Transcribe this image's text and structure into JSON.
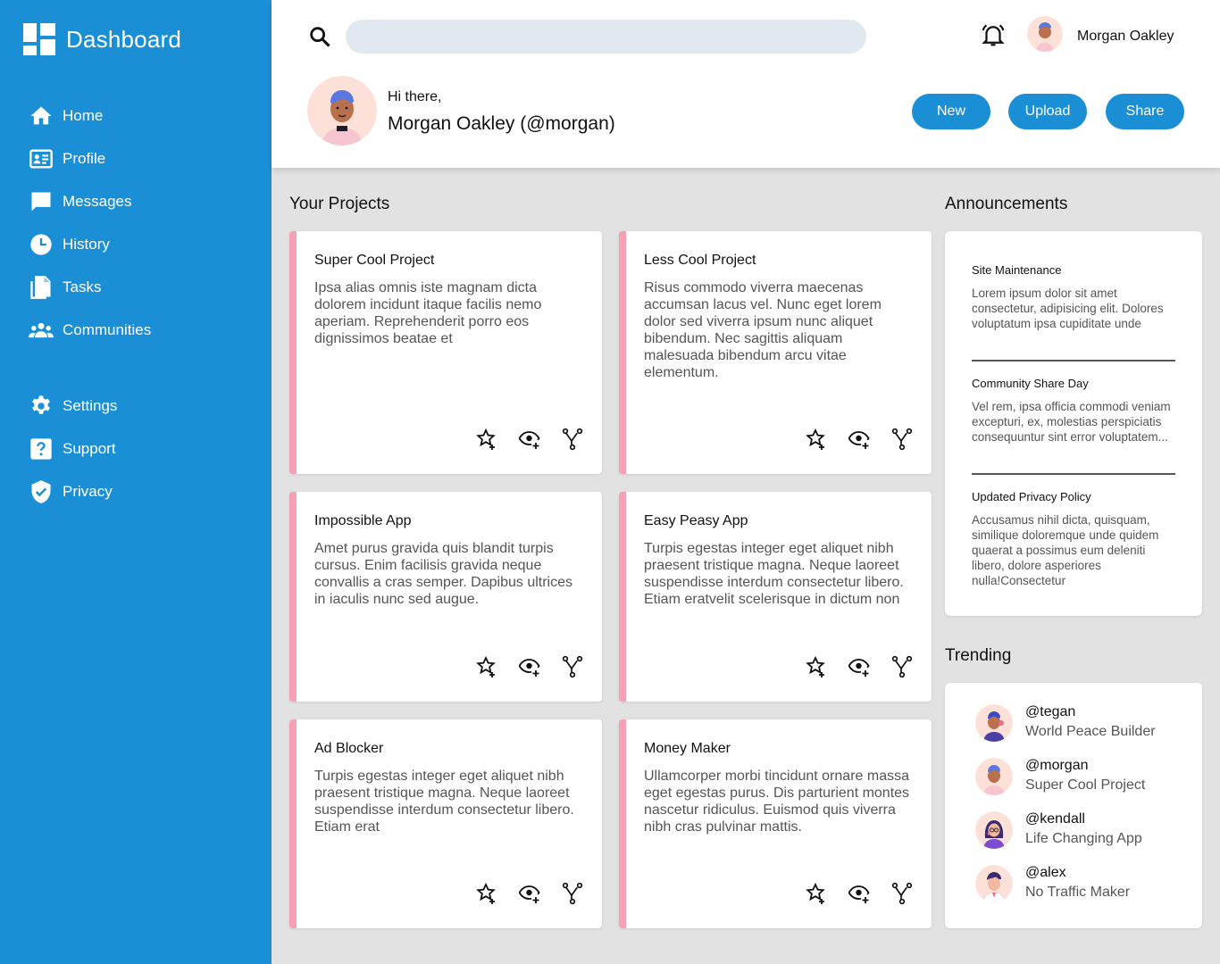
{
  "app": {
    "title": "Dashboard"
  },
  "sidebar": {
    "items": [
      {
        "label": "Home",
        "icon": "home-icon"
      },
      {
        "label": "Profile",
        "icon": "profile-card-icon"
      },
      {
        "label": "Messages",
        "icon": "message-icon"
      },
      {
        "label": "History",
        "icon": "clock-icon"
      },
      {
        "label": "Tasks",
        "icon": "documents-icon"
      },
      {
        "label": "Communities",
        "icon": "group-icon"
      }
    ],
    "secondary": [
      {
        "label": "Settings",
        "icon": "gear-icon"
      },
      {
        "label": "Support",
        "icon": "question-icon"
      },
      {
        "label": "Privacy",
        "icon": "shield-check-icon"
      }
    ]
  },
  "header": {
    "search": {
      "value": "",
      "placeholder": ""
    },
    "user_name": "Morgan Oakley",
    "greeting_small": "Hi there,",
    "greeting_big": "Morgan Oakley (@morgan)",
    "buttons": {
      "new": "New",
      "upload": "Upload",
      "share": "Share"
    }
  },
  "projects": {
    "title": "Your Projects",
    "cards": [
      {
        "title": "Super Cool Project",
        "desc": "Ipsa alias omnis iste magnam dicta dolorem incidunt itaque facilis nemo aperiam. Reprehenderit porro eos dignissimos beatae et"
      },
      {
        "title": "Less Cool Project",
        "desc": "Risus commodo viverra maecenas accumsan lacus vel. Nunc eget lorem dolor sed viverra ipsum nunc aliquet bibendum. Nec sagittis aliquam malesuada bibendum arcu vitae elementum."
      },
      {
        "title": "Impossible App",
        "desc": "Amet purus gravida quis blandit turpis cursus. Enim facilisis gravida neque convallis a cras semper. Dapibus ultrices in iaculis nunc sed augue."
      },
      {
        "title": "Easy Peasy App",
        "desc": "Turpis egestas integer eget aliquet nibh praesent tristique magna. Neque laoreet suspendisse interdum consectetur libero. Etiam eratvelit scelerisque in dictum non"
      },
      {
        "title": "Ad Blocker",
        "desc": "Turpis egestas integer eget aliquet nibh praesent tristique magna. Neque laoreet suspendisse interdum consectetur libero. Etiam erat"
      },
      {
        "title": "Money Maker",
        "desc": "Ullamcorper morbi tincidunt ornare massa eget egestas purus. Dis parturient montes nascetur ridiculus. Euismod quis viverra nibh cras pulvinar mattis."
      }
    ]
  },
  "announcements": {
    "title": "Announcements",
    "items": [
      {
        "title": "Site Maintenance",
        "body": "Lorem ipsum dolor sit amet consectetur, adipisicing elit. Dolores voluptatum ipsa cupiditate unde"
      },
      {
        "title": "Community Share Day",
        "body": "Vel rem, ipsa officia commodi veniam excepturi, ex, molestias perspiciatis consequuntur sint error voluptatem..."
      },
      {
        "title": "Updated Privacy Policy",
        "body": "Accusamus nihil dicta, quisquam, similique doloremque unde quidem quaerat a possimus eum deleniti libero, dolore asperiores nulla!Consectetur"
      }
    ]
  },
  "trending": {
    "title": "Trending",
    "items": [
      {
        "handle": "@tegan",
        "project": "World Peace Builder"
      },
      {
        "handle": "@morgan",
        "project": "Super Cool Project"
      },
      {
        "handle": "@kendall",
        "project": "Life Changing App"
      },
      {
        "handle": "@alex",
        "project": "No Traffic Maker"
      }
    ]
  },
  "colors": {
    "accent": "#1a8fd6",
    "card_stripe": "#f5a0b4",
    "background": "#e2e2e2"
  }
}
